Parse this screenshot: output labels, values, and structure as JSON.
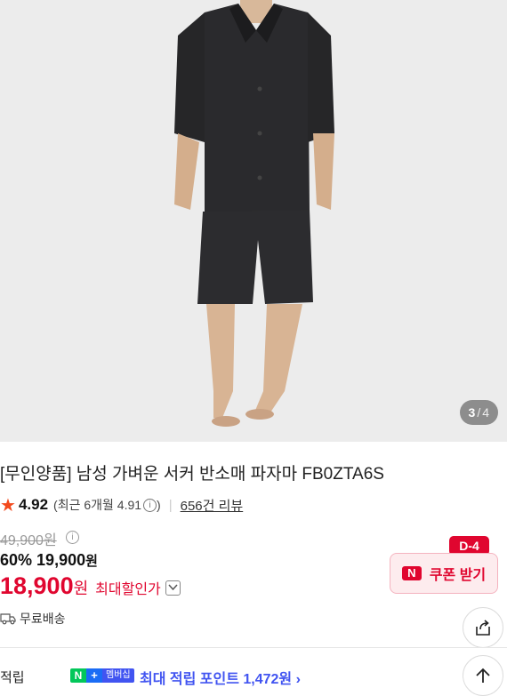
{
  "gallery": {
    "current": "3",
    "separator": "/",
    "total": "4"
  },
  "product": {
    "title": "[무인양품] 남성 가벼운 서커 반소매 파자마 FB0ZTA6S",
    "rating": "4.92",
    "recent_rating": "(최근 6개월 4.91",
    "recent_rating_close": ")",
    "reviews": "656건 리뷰"
  },
  "price": {
    "original": "49,900원",
    "discount_rate": "60%",
    "sale": "19,900",
    "sale_unit": "원",
    "final": "18,900",
    "final_unit": "원",
    "max_discount": "최대할인가"
  },
  "coupon": {
    "dday": "D-4",
    "logo": "N",
    "label": "쿠폰 받기"
  },
  "shipping": {
    "label": "무료배송"
  },
  "points": {
    "label": "적립",
    "badge_n": "N",
    "badge_plus": "+",
    "badge_member": "멤버십",
    "text": "최대 적립 포인트 1,472원 ›"
  },
  "colors": {
    "accent_red": "#e0062f",
    "star": "#f24a1d",
    "membership_blue": "#4154f1",
    "naver_green": "#03c75a"
  }
}
